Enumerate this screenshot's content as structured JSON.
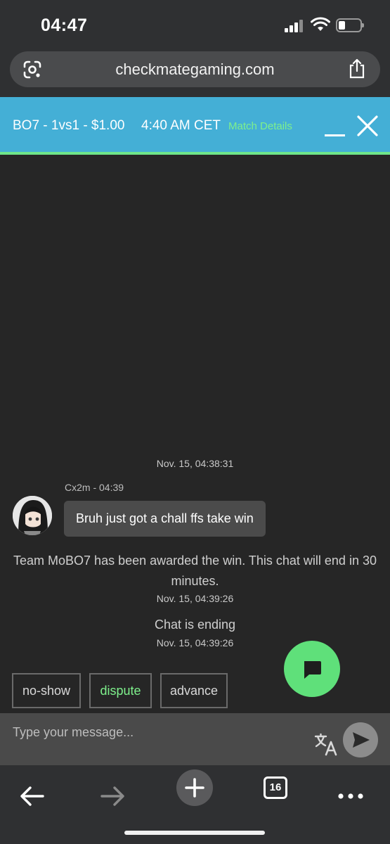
{
  "status_bar": {
    "time": "04:47"
  },
  "browser": {
    "url": "checkmategaming.com",
    "open_tabs": "16"
  },
  "match": {
    "title": "BO7 - 1vs1 - $1.00",
    "time": "4:40 AM CET",
    "details_link": "Match Details"
  },
  "chat": {
    "first_timestamp": "Nov. 15, 04:38:31",
    "message": {
      "sender_line": "Cx2m - 04:39",
      "text": "Bruh just got a chall ffs take win"
    },
    "system_messages": [
      {
        "text": "Team MoBO7 has been awarded the win. This chat will end in 30 minutes.",
        "timestamp": "Nov. 15, 04:39:26"
      },
      {
        "text": "Chat is ending",
        "timestamp": "Nov. 15, 04:39:26"
      }
    ]
  },
  "actions": {
    "no_show": "no-show",
    "dispute": "dispute",
    "advance": "advance"
  },
  "input": {
    "placeholder": "Type your message..."
  },
  "colors": {
    "header_bg": "#44afd6",
    "accent_green": "#7ef08c",
    "fab_green": "#5fe07a",
    "background": "#262626"
  },
  "icons": [
    "google-lens-icon",
    "share-icon",
    "minimize-icon",
    "close-icon",
    "chat-icon",
    "translate-icon",
    "send-icon",
    "back-arrow-icon",
    "forward-arrow-icon",
    "new-tab-icon",
    "more-icon"
  ]
}
